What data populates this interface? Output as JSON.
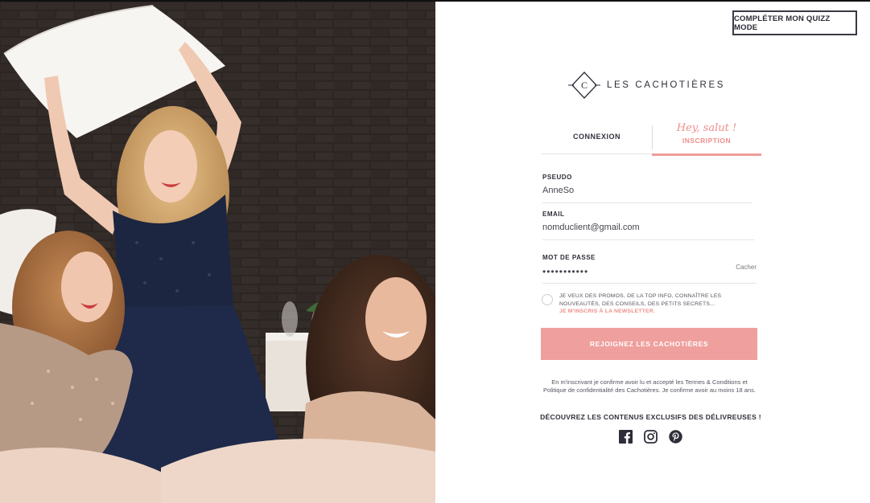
{
  "header": {
    "quiz_button_label": "COMPLÉTER MON QUIZZ MODE"
  },
  "brand": {
    "logo_letter": "C",
    "name": "LES CACHOTIÈRES"
  },
  "tabs": {
    "connexion_label": "CONNEXION",
    "greeting": "Hey, salut !",
    "inscription_label": "INSCRIPTION",
    "active": "inscription"
  },
  "form": {
    "pseudo_label": "PSEUDO",
    "pseudo_value": "AnneSo",
    "email_label": "EMAIL",
    "email_value": "nomduclient@gmail.com",
    "password_label": "MOT DE PASSE",
    "password_value": "•••••••••••",
    "hide_password_label": "Cacher"
  },
  "newsletter": {
    "checked": false,
    "text": "JE VEUX DES PROMOS, DE LA TOP INFO, CONNAÎTRE LES NOUVEAUTÉS, DES CONSEILS, DES PETITS SECRETS...",
    "link_label": "JE M'INSCRIS À LA NEWSLETTER."
  },
  "submit_label": "REJOIGNEZ LES CACHOTIÈRES",
  "legal_text": "En m'inscrivant je confirme avoir lu et accepté les Termes & Conditions et Politique de confidentialité des Cachotières. Je confirme avoir au moins 18 ans.",
  "discover_text": "DÉCOUVREZ LES CONTENUS EXCLUSIFS DES DÉLIVREUSES !",
  "socials": [
    "facebook-icon",
    "instagram-icon",
    "pinterest-icon"
  ],
  "colors": {
    "accent": "#EF9F9D",
    "dark_text": "#2E2E38",
    "brick_wall": "#2A2422"
  }
}
